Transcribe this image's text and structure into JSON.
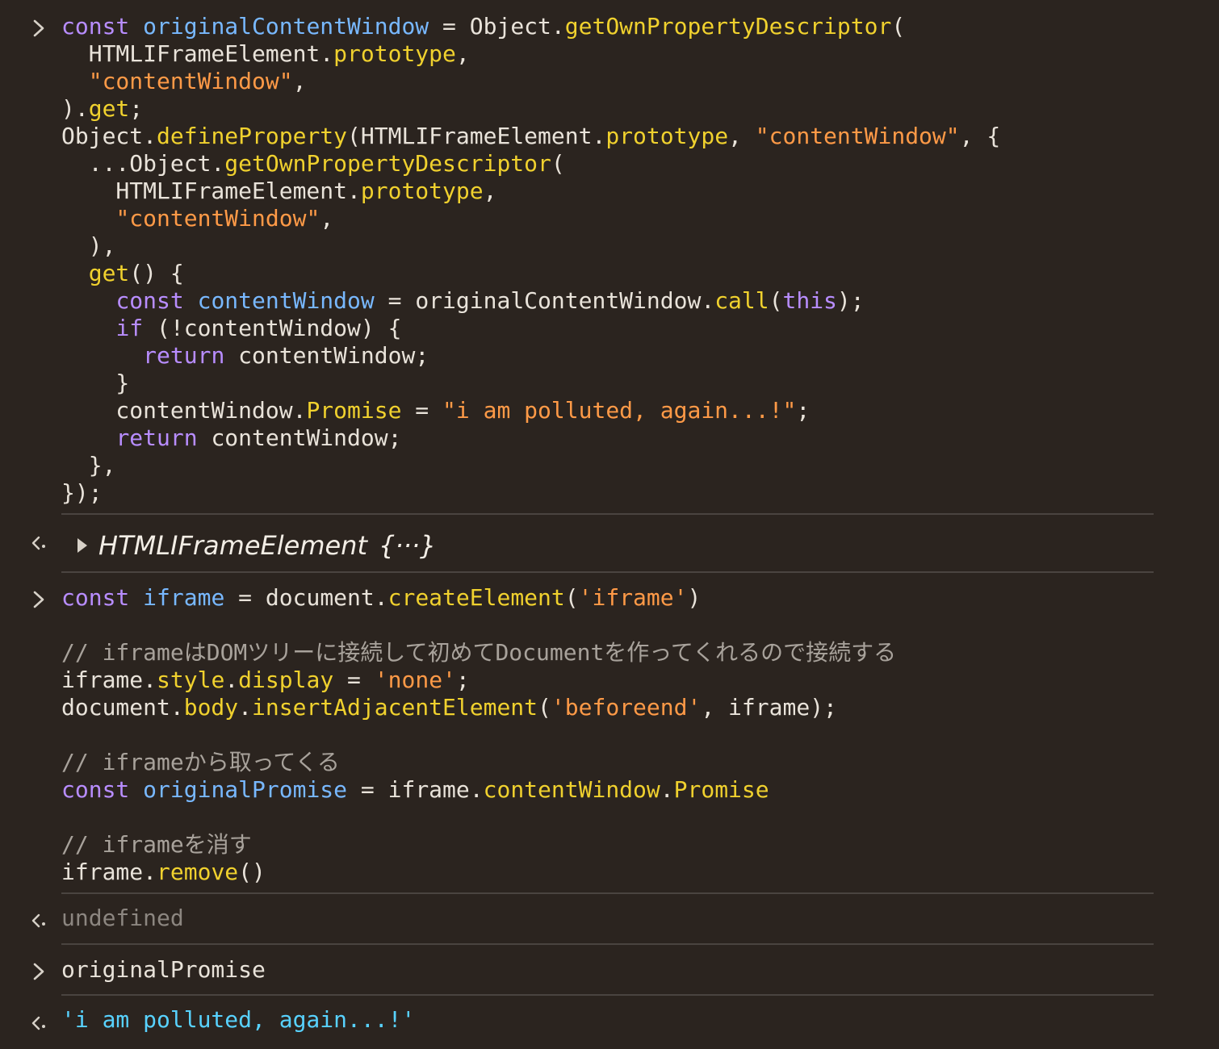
{
  "entry1": {
    "lines": [
      [
        [
          "k",
          "const"
        ],
        [
          "p",
          " "
        ],
        [
          "v",
          "originalContentWindow"
        ],
        [
          "p",
          " = Object."
        ],
        [
          "f",
          "getOwnPropertyDescriptor"
        ],
        [
          "p",
          "("
        ]
      ],
      [
        [
          "p",
          "  HTMLIFrameElement."
        ],
        [
          "f",
          "prototype"
        ],
        [
          "p",
          ","
        ]
      ],
      [
        [
          "p",
          "  "
        ],
        [
          "s",
          "\"contentWindow\""
        ],
        [
          "p",
          ","
        ]
      ],
      [
        [
          "p",
          ")."
        ],
        [
          "f",
          "get"
        ],
        [
          "p",
          ";"
        ]
      ],
      [
        [
          "p",
          "Object."
        ],
        [
          "f",
          "defineProperty"
        ],
        [
          "p",
          "(HTMLIFrameElement."
        ],
        [
          "f",
          "prototype"
        ],
        [
          "p",
          ", "
        ],
        [
          "s",
          "\"contentWindow\""
        ],
        [
          "p",
          ", {"
        ]
      ],
      [
        [
          "p",
          "  ...Object."
        ],
        [
          "f",
          "getOwnPropertyDescriptor"
        ],
        [
          "p",
          "("
        ]
      ],
      [
        [
          "p",
          "    HTMLIFrameElement."
        ],
        [
          "f",
          "prototype"
        ],
        [
          "p",
          ","
        ]
      ],
      [
        [
          "p",
          "    "
        ],
        [
          "s",
          "\"contentWindow\""
        ],
        [
          "p",
          ","
        ]
      ],
      [
        [
          "p",
          "  ),"
        ]
      ],
      [
        [
          "p",
          "  "
        ],
        [
          "f",
          "get"
        ],
        [
          "p",
          "() {"
        ]
      ],
      [
        [
          "p",
          "    "
        ],
        [
          "k",
          "const"
        ],
        [
          "p",
          " "
        ],
        [
          "v",
          "contentWindow"
        ],
        [
          "p",
          " = originalContentWindow."
        ],
        [
          "f",
          "call"
        ],
        [
          "p",
          "("
        ],
        [
          "k",
          "this"
        ],
        [
          "p",
          ");"
        ]
      ],
      [
        [
          "p",
          "    "
        ],
        [
          "k",
          "if"
        ],
        [
          "p",
          " (!contentWindow) {"
        ]
      ],
      [
        [
          "p",
          "      "
        ],
        [
          "k",
          "return"
        ],
        [
          "p",
          " contentWindow;"
        ]
      ],
      [
        [
          "p",
          "    }"
        ]
      ],
      [
        [
          "p",
          "    contentWindow."
        ],
        [
          "f",
          "Promise"
        ],
        [
          "p",
          " = "
        ],
        [
          "s",
          "\"i am polluted, again...!\""
        ],
        [
          "p",
          ";"
        ]
      ],
      [
        [
          "p",
          "    "
        ],
        [
          "k",
          "return"
        ],
        [
          "p",
          " contentWindow;"
        ]
      ],
      [
        [
          "p",
          "  },"
        ]
      ],
      [
        [
          "p",
          "});"
        ]
      ]
    ]
  },
  "result1": {
    "label": "HTMLIFrameElement",
    "suffix": "{···}"
  },
  "entry2": {
    "lines": [
      [
        [
          "k",
          "const"
        ],
        [
          "p",
          " "
        ],
        [
          "v",
          "iframe"
        ],
        [
          "p",
          " = document."
        ],
        [
          "f",
          "createElement"
        ],
        [
          "p",
          "("
        ],
        [
          "s",
          "'iframe'"
        ],
        [
          "p",
          ")"
        ]
      ],
      [
        [
          "p",
          ""
        ]
      ],
      [
        [
          "c",
          "// iframeはDOMツリーに接続して初めてDocumentを作ってくれるので接続する"
        ]
      ],
      [
        [
          "p",
          "iframe."
        ],
        [
          "f",
          "style"
        ],
        [
          "p",
          "."
        ],
        [
          "f",
          "display"
        ],
        [
          "p",
          " = "
        ],
        [
          "s",
          "'none'"
        ],
        [
          "p",
          ";"
        ]
      ],
      [
        [
          "p",
          "document."
        ],
        [
          "f",
          "body"
        ],
        [
          "p",
          "."
        ],
        [
          "f",
          "insertAdjacentElement"
        ],
        [
          "p",
          "("
        ],
        [
          "s",
          "'beforeend'"
        ],
        [
          "p",
          ", iframe);"
        ]
      ],
      [
        [
          "p",
          ""
        ]
      ],
      [
        [
          "c",
          "// iframeから取ってくる"
        ]
      ],
      [
        [
          "k",
          "const"
        ],
        [
          "p",
          " "
        ],
        [
          "v",
          "originalPromise"
        ],
        [
          "p",
          " = iframe."
        ],
        [
          "f",
          "contentWindow"
        ],
        [
          "p",
          "."
        ],
        [
          "f",
          "Promise"
        ]
      ],
      [
        [
          "p",
          ""
        ]
      ],
      [
        [
          "c",
          "// iframeを消す"
        ]
      ],
      [
        [
          "p",
          "iframe."
        ],
        [
          "f",
          "remove"
        ],
        [
          "p",
          "()"
        ]
      ]
    ]
  },
  "result2": {
    "text": "undefined"
  },
  "entry3": {
    "text": "originalPromise"
  },
  "result3": {
    "text": "'i am polluted, again...!'"
  },
  "colors": {
    "background": "#2b241f",
    "keyword": "#b88dff",
    "variable": "#78b8ff",
    "property": "#f0d12e",
    "string": "#ff9a47",
    "comment": "#a8a29b",
    "string_result": "#58d2ff"
  },
  "icons": {
    "input_prompt": "chevron-right-icon",
    "output_prompt": "return-arrow-icon",
    "expand": "disclosure-triangle-icon"
  }
}
